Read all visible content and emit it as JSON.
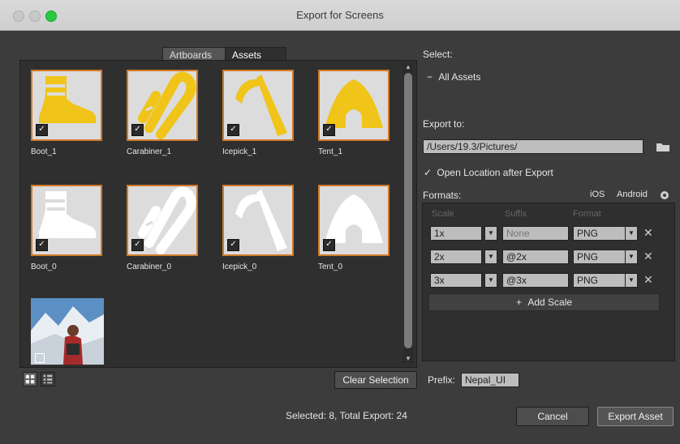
{
  "window": {
    "title": "Export for Screens"
  },
  "tabs": {
    "artboards": "Artboards",
    "assets": "Assets"
  },
  "assets": [
    {
      "label": "Boot_1",
      "checked": "✓",
      "icon": "boot-icon"
    },
    {
      "label": "Carabiner_1",
      "checked": "✓",
      "icon": "carabiner-icon"
    },
    {
      "label": "Icepick_1",
      "checked": "✓",
      "icon": "icepick-icon"
    },
    {
      "label": "Tent_1",
      "checked": "✓",
      "icon": "tent-icon"
    },
    {
      "label": "Boot_0",
      "checked": "✓",
      "icon": "boot-icon"
    },
    {
      "label": "Carabiner_0",
      "checked": "✓",
      "icon": "carabiner-icon"
    },
    {
      "label": "Icepick_0",
      "checked": "✓",
      "icon": "icepick-icon"
    },
    {
      "label": "Tent_0",
      "checked": "✓",
      "icon": "tent-icon"
    }
  ],
  "colors": {
    "accent_orange": "#d07a2a",
    "asset_yellow": "#f0c419",
    "asset_white": "#ffffff"
  },
  "select": {
    "label": "Select:",
    "all_assets": "All Assets",
    "minus_glyph": "−"
  },
  "export_to": {
    "label": "Export to:",
    "path": "/Users/19.3/Pictures/",
    "open_location_label": "Open Location after Export",
    "checkmark": "✓"
  },
  "formats": {
    "label": "Formats:",
    "ios": "iOS",
    "android": "Android",
    "headers": {
      "scale": "Scale",
      "suffix": "Suffix",
      "format": "Format"
    },
    "rows": [
      {
        "scale": "1x",
        "suffix": "",
        "suffix_placeholder": "None",
        "format": "PNG"
      },
      {
        "scale": "2x",
        "suffix": "@2x",
        "format": "PNG"
      },
      {
        "scale": "3x",
        "suffix": "@3x",
        "format": "PNG"
      }
    ],
    "add_scale": "Add Scale",
    "plus_glyph": "+",
    "dropdown_glyph": "▼",
    "remove_glyph": "✕"
  },
  "bottom": {
    "clear_selection": "Clear Selection",
    "prefix_label": "Prefix:",
    "prefix_value": "Nepal_UI",
    "status": "Selected: 8, Total Export: 24",
    "cancel": "Cancel",
    "export_asset": "Export Asset"
  }
}
